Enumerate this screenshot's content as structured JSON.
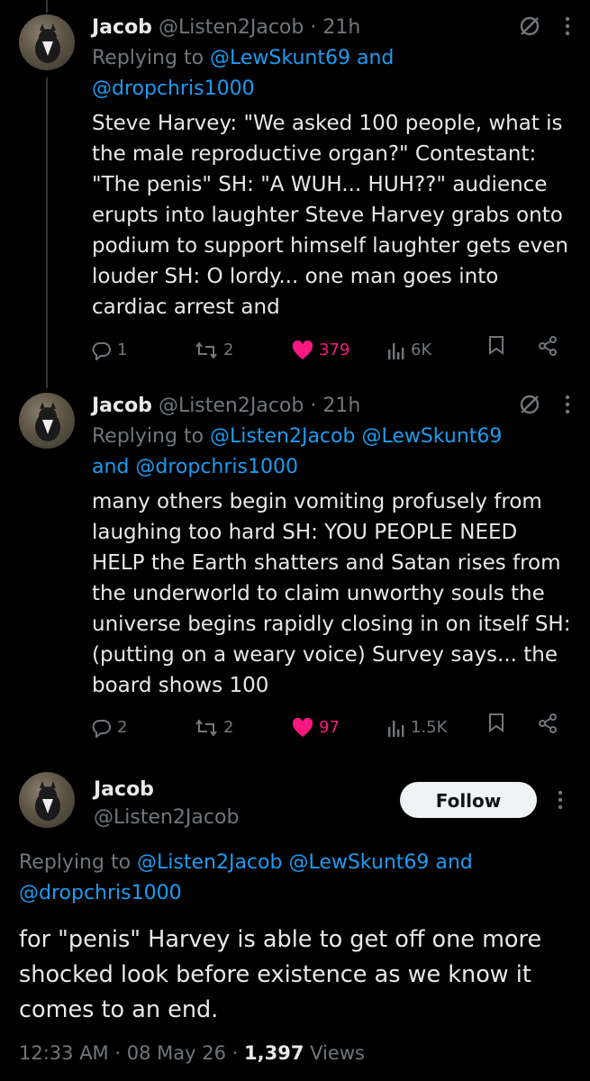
{
  "tweets": [
    {
      "name": "Jacob",
      "handle": "@Listen2Jacob",
      "sep": "·",
      "time": "21h",
      "replying_prefix": "Replying to",
      "mention_line1": "@LewSkunt69 and",
      "mention_line2": "@dropchris1000",
      "text": "Steve Harvey: \"We asked 100 people, what is the male reproductive organ?\" Contestant: \"The penis\" SH: \"A WUH... HUH??\" audience erupts into laughter Steve Harvey grabs onto podium to support himself laughter gets even louder SH: O lordy... one man goes into cardiac arrest and",
      "replies": "1",
      "retweets": "2",
      "likes": "379",
      "views": "6K"
    },
    {
      "name": "Jacob",
      "handle": "@Listen2Jacob",
      "sep": "·",
      "time": "21h",
      "replying_prefix": "Replying to",
      "mention_line1": "@Listen2Jacob @LewSkunt69",
      "mention_line2": "and @dropchris1000",
      "text": "many others begin vomiting profusely from laughing too hard SH: YOU PEOPLE NEED HELP the Earth shatters and Satan rises from the underworld to claim unworthy souls the universe begins rapidly closing in on itself SH: (putting on a weary voice) Survey says... the board shows 100",
      "replies": "2",
      "retweets": "2",
      "likes": "97",
      "views": "1.5K"
    }
  ],
  "main": {
    "name": "Jacob",
    "handle": "@Listen2Jacob",
    "follow_label": "Follow",
    "replying_prefix": "Replying to",
    "mentions_line1": "@Listen2Jacob @LewSkunt69 and",
    "mentions_line2": "@dropchris1000",
    "text": "for \"penis\" Harvey is able to get off one more shocked look before existence as we know it comes to an end.",
    "time": "12:33 AM",
    "sep": "·",
    "date": "08 May 26",
    "sep2": "·",
    "views_count": "1,397",
    "views_label": "Views"
  },
  "colors": {
    "accent": "#1d9bf0",
    "like": "#f91880",
    "muted": "#71767b"
  },
  "icons": [
    "grok-icon",
    "more-icon",
    "reply-icon",
    "retweet-icon",
    "heart-icon",
    "views-icon",
    "bookmark-icon",
    "share-icon"
  ]
}
